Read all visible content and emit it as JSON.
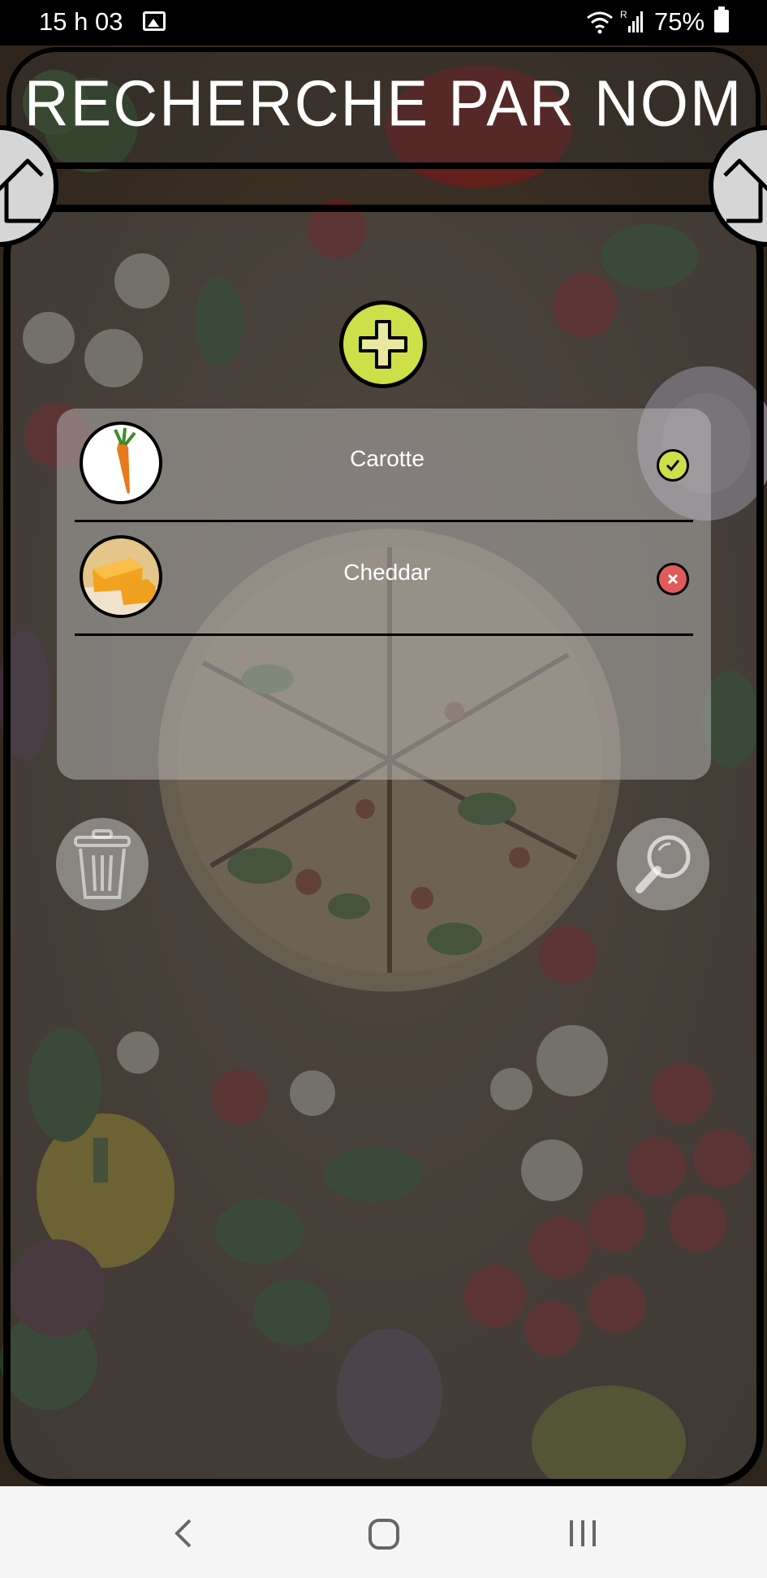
{
  "status_bar": {
    "time": "15 h 03",
    "battery": "75%",
    "icons": [
      "gallery-icon",
      "wifi-icon",
      "signal-icon",
      "battery-icon"
    ]
  },
  "header": {
    "title": "RECHERCHE PAR NOM",
    "home_icons": [
      "home-icon",
      "home-icon"
    ]
  },
  "actions": {
    "add_icon": "plus-icon",
    "delete_icon": "trash-icon",
    "search_icon": "magnifier-icon"
  },
  "ingredients": [
    {
      "name": "Carotte",
      "thumbnail": "carrot-image",
      "status": "selected",
      "status_icon": "check-icon"
    },
    {
      "name": "Cheddar",
      "thumbnail": "cheese-image",
      "status": "excluded",
      "status_icon": "cross-icon"
    }
  ],
  "colors": {
    "accent_green": "#cde04a",
    "status_red": "#e05a5a",
    "frame_black": "#000000"
  },
  "nav_bar": {
    "icons": [
      "back-icon",
      "home-circle-icon",
      "recent-apps-icon"
    ]
  }
}
